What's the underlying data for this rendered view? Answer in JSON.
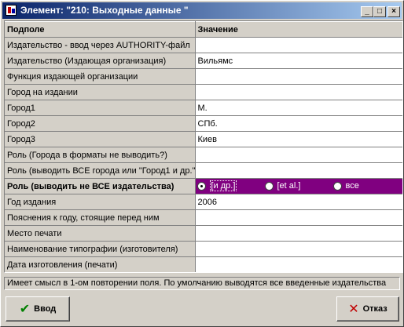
{
  "window": {
    "title": "Элемент: \"210: Выходные данные \"",
    "controls": {
      "minimize": "_",
      "maximize": "□",
      "close": "×"
    }
  },
  "grid": {
    "headers": [
      "Подполе",
      "Значение"
    ],
    "rows": [
      {
        "field": "Издательство - ввод через AUTHORITY-файл",
        "value": ""
      },
      {
        "field": "Издательство (Издающая организация)",
        "value": "Вильямс"
      },
      {
        "field": "Функция издающей организации",
        "value": ""
      },
      {
        "field": "Город на издании",
        "value": ""
      },
      {
        "field": "Город1",
        "value": "М."
      },
      {
        "field": "Город2",
        "value": "СПб."
      },
      {
        "field": "Город3",
        "value": "Киев"
      },
      {
        "field": "Роль (Города в форматы не выводить?)",
        "value": ""
      },
      {
        "field": "Роль (выводить ВСЕ города или \"Город1 и др.\"",
        "value": ""
      },
      {
        "field": "Роль (выводить не ВСЕ издательства)",
        "value": ""
      },
      {
        "field": "Год издания",
        "value": "2006"
      },
      {
        "field": "Пояснения к году, стоящие перед ним",
        "value": ""
      },
      {
        "field": "Место печати",
        "value": ""
      },
      {
        "field": "Наименование типографии (изготовителя)",
        "value": ""
      },
      {
        "field": "Дата изготовления (печати)",
        "value": ""
      }
    ],
    "selected_row": 9,
    "selected_options": [
      {
        "label": "[и др.]",
        "checked": true
      },
      {
        "label": "[et al.]",
        "checked": false
      },
      {
        "label": "все",
        "checked": false
      }
    ]
  },
  "status": {
    "text": "Имеет смысл в 1-ом повторении поля. По умолчанию выводятся все введенные издательства"
  },
  "buttons": {
    "ok_label": "Ввод",
    "cancel_label": "Отказ"
  },
  "colors": {
    "selected_row_bg": "#800080",
    "titlebar_start": "#0a246a",
    "titlebar_end": "#a6caf0"
  }
}
